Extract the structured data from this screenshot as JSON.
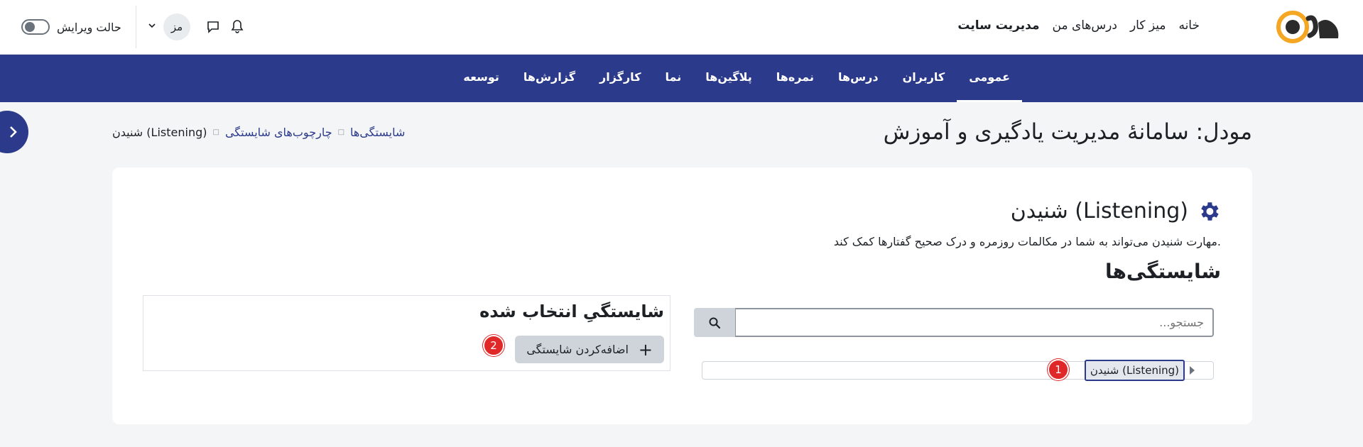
{
  "header": {
    "nav": [
      {
        "label": "خانه"
      },
      {
        "label": "میز کار"
      },
      {
        "label": "درس‌های من"
      },
      {
        "label": "مدیریت سایت"
      }
    ],
    "avatar_initials": "مز",
    "edit_mode_label": "حالت ویرایش"
  },
  "primary_nav": [
    {
      "label": "عمومی"
    },
    {
      "label": "کاربران"
    },
    {
      "label": "درس‌ها"
    },
    {
      "label": "نمره‌ها"
    },
    {
      "label": "پلاگین‌ها"
    },
    {
      "label": "نما"
    },
    {
      "label": "کارگزار"
    },
    {
      "label": "گزارش‌ها"
    },
    {
      "label": "توسعه"
    }
  ],
  "page": {
    "title": "مودل: سامانهٔ مدیریت یادگیری و آموزش",
    "breadcrumb": [
      "شایستگی‌ها",
      "چارچوب‌های شایستگی",
      "شنیدن (Listening)"
    ]
  },
  "framework": {
    "title": "شنیدن (Listening)",
    "description": "مهارت شنیدن می‌تواند به شما در مکالمات روزمره و درک صحیح گفتارها کمک کند.",
    "competencies_heading": "شایستگی‌ها"
  },
  "search": {
    "placeholder": "جستجو..."
  },
  "tree": {
    "node_label": "شنیدن (Listening)"
  },
  "selected": {
    "title": "شایستگیِ انتخاب شده",
    "add_button": "اضافه‌کردن شایستگی"
  },
  "badges": {
    "one": "1",
    "two": "2"
  },
  "colors": {
    "primary": "#2b3a8a",
    "badge": "#e02828",
    "logo_orange": "#f5a623"
  }
}
